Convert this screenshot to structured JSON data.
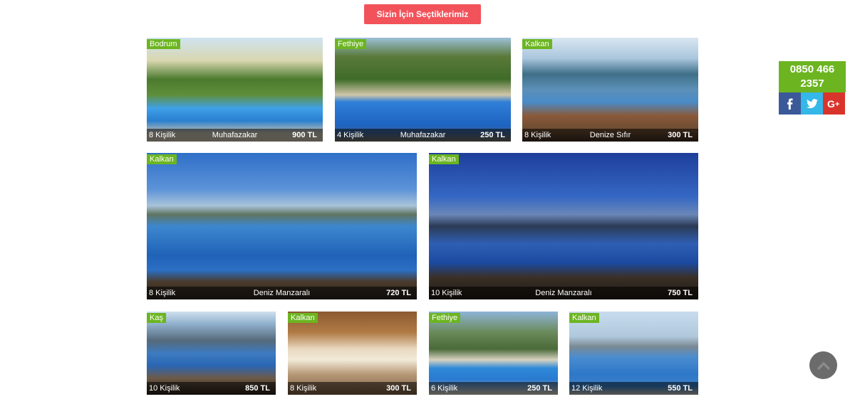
{
  "section": {
    "title": "Sizin İçin Seçtiklerimiz"
  },
  "listings": [
    {
      "location": "Bodrum",
      "capacity": "8 Kişilik",
      "feature": "Muhafazakar",
      "price": "900 TL"
    },
    {
      "location": "Fethiye",
      "capacity": "4 Kişilik",
      "feature": "Muhafazakar",
      "price": "250 TL"
    },
    {
      "location": "Kalkan",
      "capacity": "8 Kişilik",
      "feature": "Denize Sıfır",
      "price": "300 TL"
    },
    {
      "location": "Kalkan",
      "capacity": "8 Kişilik",
      "feature": "Deniz Manzaralı",
      "price": "720 TL"
    },
    {
      "location": "Kalkan",
      "capacity": "10 Kişilik",
      "feature": "Deniz Manzaralı",
      "price": "750 TL"
    },
    {
      "location": "Kaş",
      "capacity": "10 Kişilik",
      "feature": "",
      "price": "850 TL"
    },
    {
      "location": "Kalkan",
      "capacity": "8 Kişilik",
      "feature": "",
      "price": "300 TL"
    },
    {
      "location": "Fethiye",
      "capacity": "6 Kişilik",
      "feature": "",
      "price": "250 TL"
    },
    {
      "location": "Kalkan",
      "capacity": "12 Kişilik",
      "feature": "",
      "price": "550 TL"
    }
  ],
  "contact": {
    "phone": "0850 466 2357"
  },
  "social": {
    "facebook_icon": "facebook-icon",
    "twitter_icon": "twitter-icon",
    "googleplus_icon": "google-plus-icon"
  },
  "colors": {
    "accent": "#f2525a",
    "location_badge": "#6cb521",
    "phone_box": "#6cb521",
    "facebook": "#3b5998",
    "twitter": "#35b7e8",
    "googleplus": "#d9342b"
  }
}
